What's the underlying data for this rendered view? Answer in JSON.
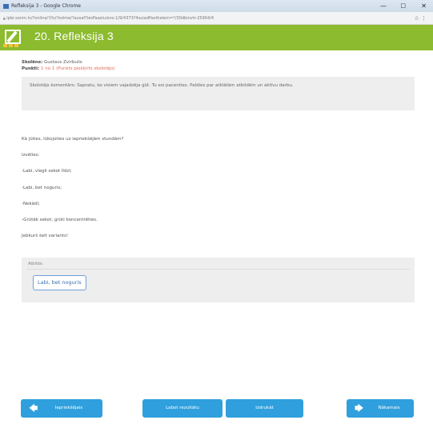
{
  "window": {
    "title": "Refleksija 3 - Google Chrome",
    "controls": {
      "minimize": "—",
      "maximize": "□",
      "close": "✕"
    },
    "url": "ipbr.sonm.lv/?online/?/lv/?ezime/?ausaf?iesPaaslu/ens-1/9/4373?4suiadPasthelem=?/30dbinvtr-25904/4",
    "toolbar_icons": "☆ ⋮"
  },
  "header": {
    "title": "20. Refleksija 3",
    "colors": {
      "bar": "#8cbb2f",
      "logo_stripe": "#f6c23b"
    },
    "icon": "edit-note-icon"
  },
  "meta": {
    "author_label": "Skolēns:",
    "author_name": "Gustavs Zvirbulis",
    "points_label": "Punkti:",
    "points_value": "1 no 1",
    "points_note": "(Punkts piešķirts skolotājs)"
  },
  "teacher_comment": "Skolotājs komentārs: Sapratu, ko visiem vajadzēja gūt. Tu esi pacenties. Paldies par atklātām atbildēm un aktīvu darbu.",
  "prompt_lines": [
    "Kā jūties, lūkojoties uz iepriekšējām stundām?",
    "Izvēlies:",
    "-Labi, viegli sekot līdzi;",
    "-Labi, bet noguris;",
    "-Nekādi;",
    "-Grūtāk sekot, grūti koncentrēties.",
    "Jebkurš šeit variants!"
  ],
  "answer": {
    "label": "Atbilde:",
    "selected": "Labi, bet noguris"
  },
  "buttons": {
    "prev": "Iepriekšējais",
    "mid1": "Labot rezultātu",
    "mid2": "Izdrukāt",
    "next": "Nākamais",
    "color": "#2fa0dd"
  }
}
